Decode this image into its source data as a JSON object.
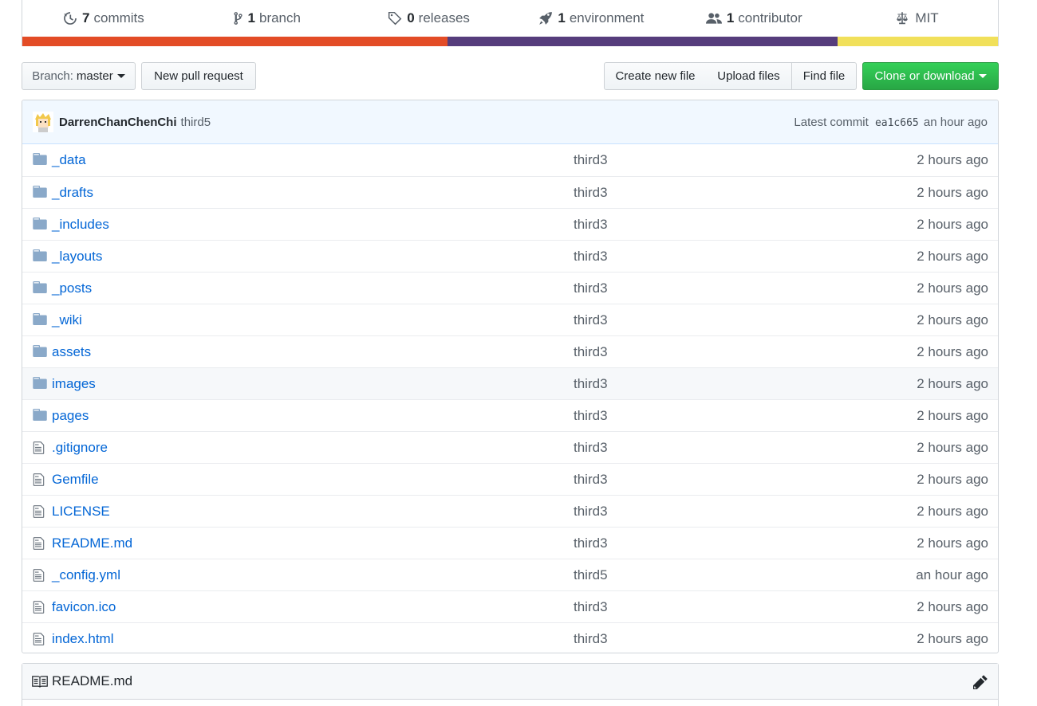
{
  "summary": {
    "commits": {
      "num": "7",
      "label": "commits",
      "icon": "history-icon"
    },
    "branches": {
      "num": "1",
      "label": "branch",
      "icon": "git-branch-icon"
    },
    "releases": {
      "num": "0",
      "label": "releases",
      "icon": "tag-icon"
    },
    "environments": {
      "num": "1",
      "label": "environment",
      "icon": "rocket-icon"
    },
    "contributors": {
      "num": "1",
      "label": "contributor",
      "icon": "people-icon"
    },
    "license": {
      "label": "MIT",
      "icon": "law-icon"
    },
    "language_colors": [
      "#e34c26",
      "#563d7c",
      "#f1e05a"
    ],
    "language_fractions": [
      0.436,
      0.4,
      0.164
    ]
  },
  "toolbar": {
    "branch_prefix": "Branch:",
    "branch_name": "master",
    "new_pr": "New pull request",
    "create_file": "Create new file",
    "upload_files": "Upload files",
    "find_file": "Find file",
    "clone": "Clone or download",
    "green": "#28a745"
  },
  "commit": {
    "author": "DarrenChanChenChi",
    "message": "third5",
    "latest_label": "Latest commit",
    "sha": "ea1c665",
    "age": "an hour ago"
  },
  "files": [
    {
      "name": "_data",
      "type": "dir",
      "message": "third3",
      "age": "2 hours ago"
    },
    {
      "name": "_drafts",
      "type": "dir",
      "message": "third3",
      "age": "2 hours ago"
    },
    {
      "name": "_includes",
      "type": "dir",
      "message": "third3",
      "age": "2 hours ago"
    },
    {
      "name": "_layouts",
      "type": "dir",
      "message": "third3",
      "age": "2 hours ago"
    },
    {
      "name": "_posts",
      "type": "dir",
      "message": "third3",
      "age": "2 hours ago"
    },
    {
      "name": "_wiki",
      "type": "dir",
      "message": "third3",
      "age": "2 hours ago"
    },
    {
      "name": "assets",
      "type": "dir",
      "message": "third3",
      "age": "2 hours ago"
    },
    {
      "name": "images",
      "type": "dir",
      "message": "third3",
      "age": "2 hours ago"
    },
    {
      "name": "pages",
      "type": "dir",
      "message": "third3",
      "age": "2 hours ago"
    },
    {
      "name": ".gitignore",
      "type": "file",
      "message": "third3",
      "age": "2 hours ago"
    },
    {
      "name": "Gemfile",
      "type": "file",
      "message": "third3",
      "age": "2 hours ago"
    },
    {
      "name": "LICENSE",
      "type": "file",
      "message": "third3",
      "age": "2 hours ago"
    },
    {
      "name": "README.md",
      "type": "file",
      "message": "third3",
      "age": "2 hours ago"
    },
    {
      "name": "_config.yml",
      "type": "file",
      "message": "third5",
      "age": "an hour ago"
    },
    {
      "name": "favicon.ico",
      "type": "file",
      "message": "third3",
      "age": "2 hours ago"
    },
    {
      "name": "index.html",
      "type": "file",
      "message": "third3",
      "age": "2 hours ago"
    }
  ],
  "readme": {
    "title": "README.md",
    "icon": "book-icon",
    "edit_icon": "pencil-icon"
  }
}
